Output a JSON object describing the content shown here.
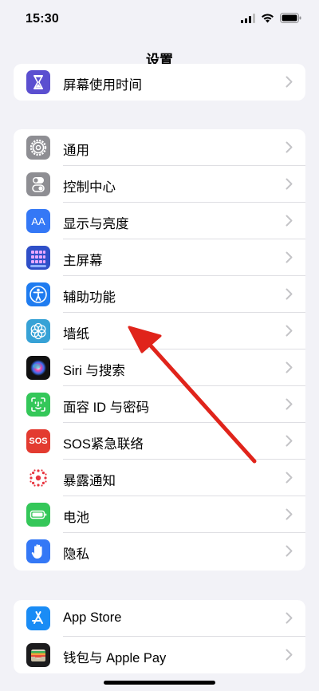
{
  "status_bar": {
    "time": "15:30"
  },
  "nav": {
    "title": "设置"
  },
  "groups": [
    {
      "items": [
        {
          "label": "屏幕使用时间",
          "icon": "hourglass-icon",
          "color": "#5b4fd0"
        }
      ]
    },
    {
      "items": [
        {
          "label": "通用",
          "icon": "gear-icon",
          "color": "#8e8e93"
        },
        {
          "label": "控制中心",
          "icon": "toggles-icon",
          "color": "#8e8e93"
        },
        {
          "label": "显示与亮度",
          "icon": "text-size-icon",
          "color": "#3478f6"
        },
        {
          "label": "主屏幕",
          "icon": "app-grid-icon",
          "color": "#2f4fc8"
        },
        {
          "label": "辅助功能",
          "icon": "accessibility-icon",
          "color": "#1f7cf0"
        },
        {
          "label": "墙纸",
          "icon": "flower-icon",
          "color": "#37a2d6"
        },
        {
          "label": "Siri 与搜索",
          "icon": "siri-icon",
          "color": "#111111"
        },
        {
          "label": "面容 ID 与密码",
          "icon": "face-id-icon",
          "color": "#34c759"
        },
        {
          "label": "SOS紧急联络",
          "icon": "sos-icon",
          "color": "#e33b30",
          "icon_text": "SOS"
        },
        {
          "label": "暴露通知",
          "icon": "exposure-icon",
          "color": "#ffffff"
        },
        {
          "label": "电池",
          "icon": "battery-icon",
          "color": "#34c759"
        },
        {
          "label": "隐私",
          "icon": "hand-icon",
          "color": "#3478f6"
        }
      ]
    },
    {
      "items": [
        {
          "label": "App Store",
          "icon": "app-store-icon",
          "color": "#1a8cf5"
        },
        {
          "label": "钱包与 Apple Pay",
          "icon": "wallet-icon",
          "color": "#1c1c1e"
        }
      ]
    }
  ],
  "annotation": {
    "color": "#e0241b"
  }
}
